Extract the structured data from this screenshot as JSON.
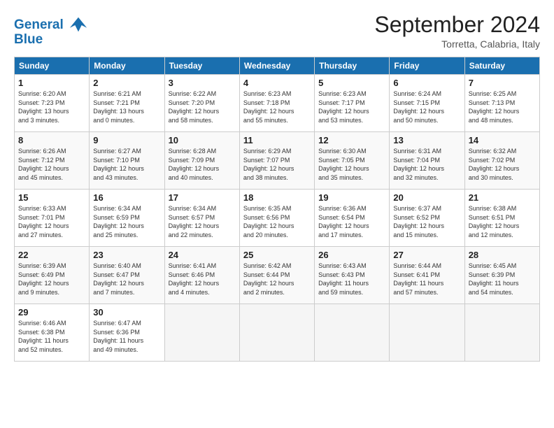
{
  "header": {
    "logo_line1": "General",
    "logo_line2": "Blue",
    "month": "September 2024",
    "location": "Torretta, Calabria, Italy"
  },
  "weekdays": [
    "Sunday",
    "Monday",
    "Tuesday",
    "Wednesday",
    "Thursday",
    "Friday",
    "Saturday"
  ],
  "weeks": [
    [
      {
        "day": "1",
        "info": "Sunrise: 6:20 AM\nSunset: 7:23 PM\nDaylight: 13 hours\nand 3 minutes."
      },
      {
        "day": "2",
        "info": "Sunrise: 6:21 AM\nSunset: 7:21 PM\nDaylight: 13 hours\nand 0 minutes."
      },
      {
        "day": "3",
        "info": "Sunrise: 6:22 AM\nSunset: 7:20 PM\nDaylight: 12 hours\nand 58 minutes."
      },
      {
        "day": "4",
        "info": "Sunrise: 6:23 AM\nSunset: 7:18 PM\nDaylight: 12 hours\nand 55 minutes."
      },
      {
        "day": "5",
        "info": "Sunrise: 6:23 AM\nSunset: 7:17 PM\nDaylight: 12 hours\nand 53 minutes."
      },
      {
        "day": "6",
        "info": "Sunrise: 6:24 AM\nSunset: 7:15 PM\nDaylight: 12 hours\nand 50 minutes."
      },
      {
        "day": "7",
        "info": "Sunrise: 6:25 AM\nSunset: 7:13 PM\nDaylight: 12 hours\nand 48 minutes."
      }
    ],
    [
      {
        "day": "8",
        "info": "Sunrise: 6:26 AM\nSunset: 7:12 PM\nDaylight: 12 hours\nand 45 minutes."
      },
      {
        "day": "9",
        "info": "Sunrise: 6:27 AM\nSunset: 7:10 PM\nDaylight: 12 hours\nand 43 minutes."
      },
      {
        "day": "10",
        "info": "Sunrise: 6:28 AM\nSunset: 7:09 PM\nDaylight: 12 hours\nand 40 minutes."
      },
      {
        "day": "11",
        "info": "Sunrise: 6:29 AM\nSunset: 7:07 PM\nDaylight: 12 hours\nand 38 minutes."
      },
      {
        "day": "12",
        "info": "Sunrise: 6:30 AM\nSunset: 7:05 PM\nDaylight: 12 hours\nand 35 minutes."
      },
      {
        "day": "13",
        "info": "Sunrise: 6:31 AM\nSunset: 7:04 PM\nDaylight: 12 hours\nand 32 minutes."
      },
      {
        "day": "14",
        "info": "Sunrise: 6:32 AM\nSunset: 7:02 PM\nDaylight: 12 hours\nand 30 minutes."
      }
    ],
    [
      {
        "day": "15",
        "info": "Sunrise: 6:33 AM\nSunset: 7:01 PM\nDaylight: 12 hours\nand 27 minutes."
      },
      {
        "day": "16",
        "info": "Sunrise: 6:34 AM\nSunset: 6:59 PM\nDaylight: 12 hours\nand 25 minutes."
      },
      {
        "day": "17",
        "info": "Sunrise: 6:34 AM\nSunset: 6:57 PM\nDaylight: 12 hours\nand 22 minutes."
      },
      {
        "day": "18",
        "info": "Sunrise: 6:35 AM\nSunset: 6:56 PM\nDaylight: 12 hours\nand 20 minutes."
      },
      {
        "day": "19",
        "info": "Sunrise: 6:36 AM\nSunset: 6:54 PM\nDaylight: 12 hours\nand 17 minutes."
      },
      {
        "day": "20",
        "info": "Sunrise: 6:37 AM\nSunset: 6:52 PM\nDaylight: 12 hours\nand 15 minutes."
      },
      {
        "day": "21",
        "info": "Sunrise: 6:38 AM\nSunset: 6:51 PM\nDaylight: 12 hours\nand 12 minutes."
      }
    ],
    [
      {
        "day": "22",
        "info": "Sunrise: 6:39 AM\nSunset: 6:49 PM\nDaylight: 12 hours\nand 9 minutes."
      },
      {
        "day": "23",
        "info": "Sunrise: 6:40 AM\nSunset: 6:47 PM\nDaylight: 12 hours\nand 7 minutes."
      },
      {
        "day": "24",
        "info": "Sunrise: 6:41 AM\nSunset: 6:46 PM\nDaylight: 12 hours\nand 4 minutes."
      },
      {
        "day": "25",
        "info": "Sunrise: 6:42 AM\nSunset: 6:44 PM\nDaylight: 12 hours\nand 2 minutes."
      },
      {
        "day": "26",
        "info": "Sunrise: 6:43 AM\nSunset: 6:43 PM\nDaylight: 11 hours\nand 59 minutes."
      },
      {
        "day": "27",
        "info": "Sunrise: 6:44 AM\nSunset: 6:41 PM\nDaylight: 11 hours\nand 57 minutes."
      },
      {
        "day": "28",
        "info": "Sunrise: 6:45 AM\nSunset: 6:39 PM\nDaylight: 11 hours\nand 54 minutes."
      }
    ],
    [
      {
        "day": "29",
        "info": "Sunrise: 6:46 AM\nSunset: 6:38 PM\nDaylight: 11 hours\nand 52 minutes."
      },
      {
        "day": "30",
        "info": "Sunrise: 6:47 AM\nSunset: 6:36 PM\nDaylight: 11 hours\nand 49 minutes."
      },
      {
        "day": "",
        "info": ""
      },
      {
        "day": "",
        "info": ""
      },
      {
        "day": "",
        "info": ""
      },
      {
        "day": "",
        "info": ""
      },
      {
        "day": "",
        "info": ""
      }
    ]
  ]
}
